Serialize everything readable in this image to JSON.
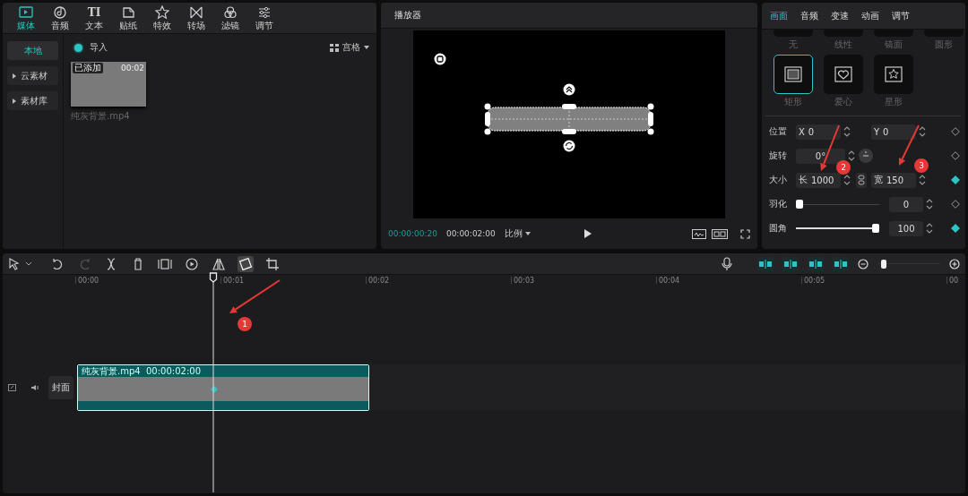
{
  "media_panel": {
    "tabs": [
      {
        "label": "媒体",
        "selected": true
      },
      {
        "label": "音频",
        "selected": false
      },
      {
        "label": "文本",
        "selected": false
      },
      {
        "label": "贴纸",
        "selected": false
      },
      {
        "label": "特效",
        "selected": false
      },
      {
        "label": "转场",
        "selected": false
      },
      {
        "label": "滤镜",
        "selected": false
      },
      {
        "label": "调节",
        "selected": false
      }
    ],
    "tab_glyph": "TI",
    "sidebar": [
      {
        "label": "本地",
        "selected": true
      },
      {
        "label": "云素材",
        "selected": false,
        "expanded": false
      },
      {
        "label": "素材库",
        "selected": false,
        "expanded": false
      }
    ],
    "import_label": "导入",
    "view_label": "宫格",
    "items": [
      {
        "name": "纯灰背景.mp4",
        "duration": "00:02",
        "badge": "已添加"
      }
    ]
  },
  "player": {
    "title": "播放器",
    "current_time": "00:00:00:20",
    "total_time": "00:00:02:00",
    "ratio_label": "比例"
  },
  "inspector": {
    "tabs": [
      {
        "label": "画面",
        "selected": true
      },
      {
        "label": "音频",
        "selected": false
      },
      {
        "label": "变速",
        "selected": false
      },
      {
        "label": "动画",
        "selected": false
      },
      {
        "label": "调节",
        "selected": false
      }
    ],
    "masks": [
      {
        "label": "无",
        "selected": false,
        "partial": true
      },
      {
        "label": "线性",
        "selected": false,
        "partial": true
      },
      {
        "label": "镜面",
        "selected": false,
        "partial": true
      },
      {
        "label": "圆形",
        "selected": false,
        "partial": true
      },
      {
        "kind": "rect",
        "label": "矩形",
        "selected": true,
        "partial": false
      },
      {
        "kind": "heart",
        "label": "爱心",
        "selected": false,
        "partial": false
      },
      {
        "kind": "star",
        "label": "星形",
        "selected": false,
        "partial": false
      }
    ],
    "properties": [
      {
        "kind": "pair",
        "label": "位置",
        "fields": [
          {
            "prefix": "X",
            "value": "0"
          },
          {
            "prefix": "Y",
            "value": "0"
          }
        ],
        "keyframe": false
      },
      {
        "kind": "rotation",
        "label": "旋转",
        "value": "0°",
        "keyframe": false
      },
      {
        "kind": "pair",
        "label": "大小",
        "fields": [
          {
            "prefix": "长",
            "value": "1000"
          },
          {
            "prefix": "宽",
            "value": "150"
          }
        ],
        "linked": true,
        "keyframe": true
      },
      {
        "kind": "slider",
        "label": "羽化",
        "level": 0,
        "value": "0",
        "keyframe": false
      },
      {
        "kind": "slider",
        "label": "圆角",
        "level": 1,
        "value": "100",
        "keyframe": true
      }
    ]
  },
  "timeline": {
    "zoom": {
      "level": 0.05
    },
    "ruler": [
      "00:00",
      "00:01",
      "00:02",
      "00:03",
      "00:04",
      "00:05",
      "00"
    ],
    "cover_label": "封面",
    "clip": {
      "name": "纯灰背景.mp4",
      "duration": "00:00:02:00"
    }
  },
  "annotations": [
    {
      "label": "1"
    },
    {
      "label": "2"
    },
    {
      "label": "3"
    }
  ]
}
